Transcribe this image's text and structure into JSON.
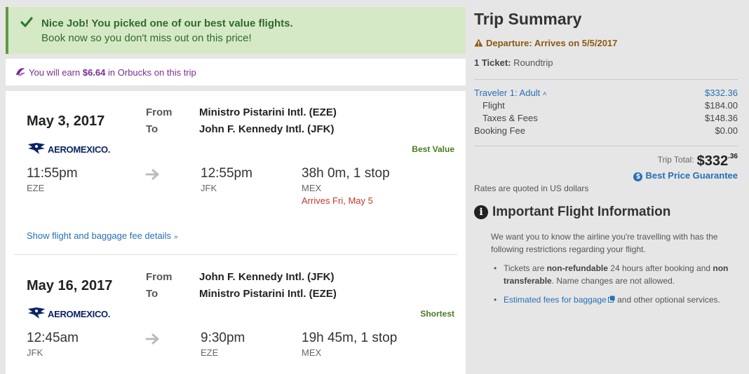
{
  "alert": {
    "title": "Nice Job! You picked one of our best value flights.",
    "subtitle": "Book now so you don't miss out on this price!"
  },
  "orbucks": {
    "prefix": "You will earn",
    "amount": "$6.64",
    "suffix": "in Orbucks on this trip"
  },
  "legs": [
    {
      "date": "May 3, 2017",
      "from_label": "From",
      "to_label": "To",
      "from_airport": "Ministro Pistarini Intl. (EZE)",
      "to_airport": "John F. Kennedy Intl. (JFK)",
      "airline": "AEROMEXICO.",
      "tag": "Best Value",
      "depart_time": "11:55pm",
      "depart_code": "EZE",
      "arrive_time": "12:55pm",
      "arrive_code": "JFK",
      "duration": "38h 0m, 1 stop",
      "stop_code": "MEX",
      "arrives_note": "Arrives Fri, May 5"
    },
    {
      "date": "May 16, 2017",
      "from_label": "From",
      "to_label": "To",
      "from_airport": "John F. Kennedy Intl. (JFK)",
      "to_airport": "Ministro Pistarini Intl. (EZE)",
      "airline": "AEROMEXICO.",
      "tag": "Shortest",
      "depart_time": "12:45am",
      "depart_code": "JFK",
      "arrive_time": "9:30pm",
      "arrive_code": "EZE",
      "duration": "19h 45m, 1 stop",
      "stop_code": "MEX"
    }
  ],
  "details_link": "Show flight and baggage fee details",
  "summary": {
    "title": "Trip Summary",
    "departure_notice": "Departure: Arrives on 5/5/2017",
    "ticket_label": "1 Ticket:",
    "ticket_type": "Roundtrip",
    "traveler_label": "Traveler 1: Adult",
    "traveler_total": "$332.36",
    "flight_label": "Flight",
    "flight_amount": "$184.00",
    "taxes_label": "Taxes & Fees",
    "taxes_amount": "$148.36",
    "booking_label": "Booking Fee",
    "booking_amount": "$0.00",
    "trip_total_label": "Trip Total:",
    "trip_total_main": "$332",
    "trip_total_cents": ".36",
    "best_price": "Best Price Guarantee",
    "rates_note": "Rates are quoted in US dollars"
  },
  "info": {
    "title": "Important Flight Information",
    "intro": "We want you to know the airline you're travelling with has the following restrictions regarding your flight.",
    "b1_pre": "Tickets are",
    "b1_bold1": "non-refundable",
    "b1_mid": "24 hours after booking and",
    "b1_bold2": "non transferable",
    "b1_post": ". Name changes are not allowed.",
    "b2_link": "Estimated fees for baggage",
    "b2_post": "and other optional services."
  },
  "colors": {
    "success_bg": "#d6e9c6",
    "link": "#2770b5",
    "orbucks": "#7b2e8e",
    "warning": "#8a5a12",
    "arrives": "#c0392b"
  }
}
